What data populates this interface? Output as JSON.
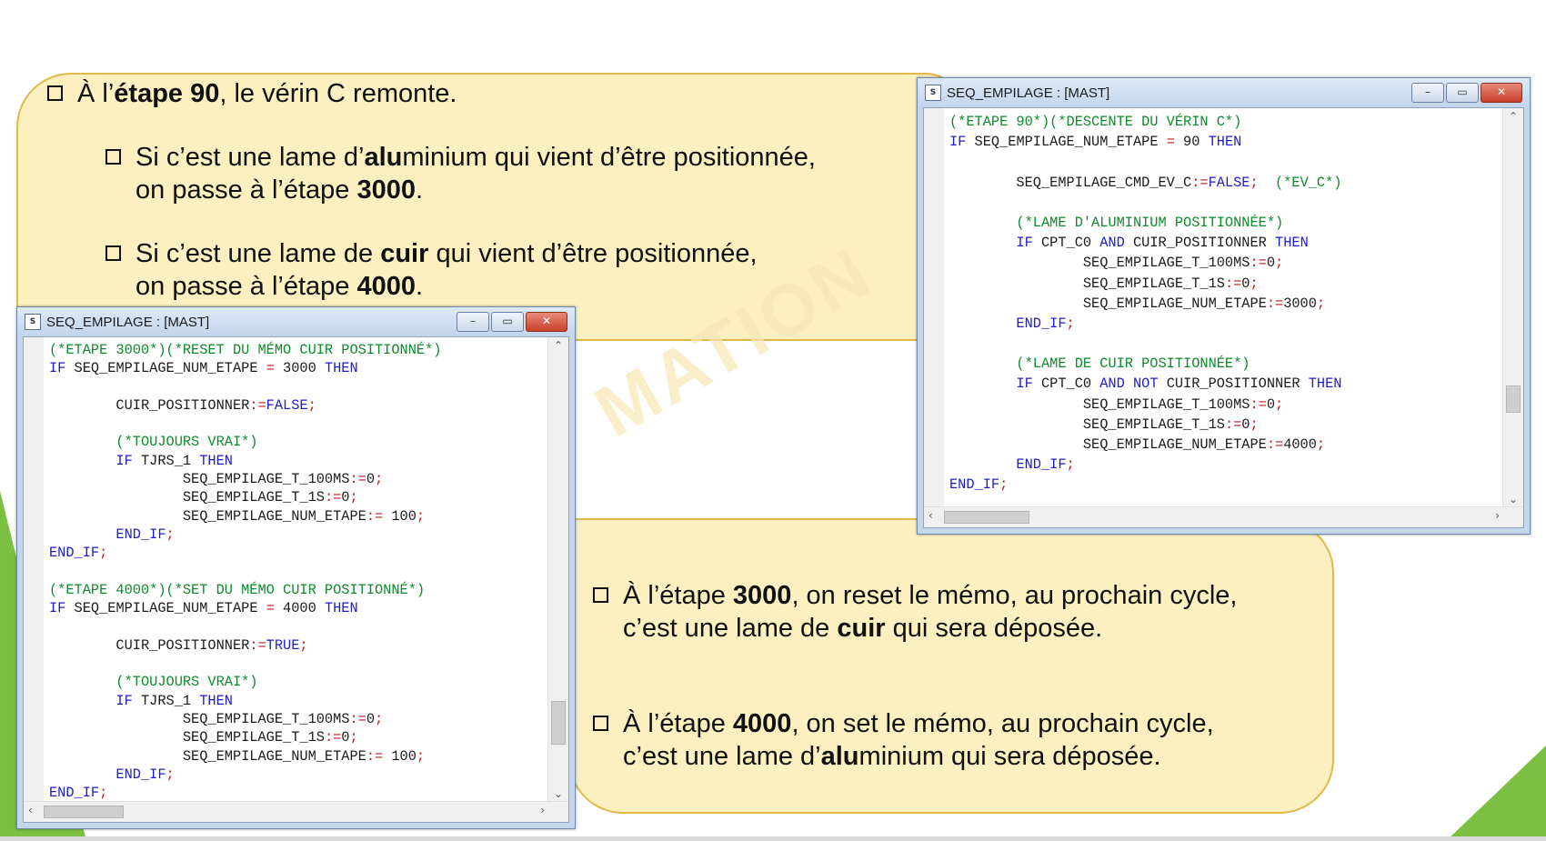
{
  "top_callout": {
    "b1": {
      "pre": "À l’",
      "bold": "étape 90",
      "post": ", le vérin C remonte."
    },
    "b2": {
      "pre": "Si c’est une lame d’",
      "bold": "alu",
      "post": "minium qui vient d’être positionnée,",
      "l2pre": "on passe à l’étape ",
      "l2bold": "3000",
      "l2post": "."
    },
    "b3": {
      "pre": "Si c’est une lame de ",
      "bold": "cuir",
      "post": " qui vient d’être positionnée,",
      "l2pre": "on passe à l’étape ",
      "l2bold": "4000",
      "l2post": "."
    }
  },
  "bottom_callout": {
    "b1": {
      "pre": "À l’étape ",
      "bold": "3000",
      "post": ", on reset le mémo, au prochain cycle,",
      "l2pre": "c’est une lame de ",
      "l2bold": "cuir",
      "l2post": " qui sera déposée."
    },
    "b2": {
      "pre": "À l’étape ",
      "bold": "4000",
      "post": ", on set le mémo, au prochain cycle,",
      "l2pre": "c’est une lame d’",
      "l2bold": "alu",
      "l2post": "minium qui sera déposée."
    }
  },
  "watermark": "MATION",
  "window_left": {
    "title": "SEQ_EMPILAGE : [MAST]",
    "icon": "st-editor-icon",
    "lines": [
      [
        [
          "c",
          "(*ETAPE 3000*)(*RESET DU MÉMO CUIR POSITIONNÉ*)"
        ]
      ],
      [
        [
          "k",
          "IF "
        ],
        [
          "i",
          "SEQ_EMPILAGE_NUM_ETAPE "
        ],
        [
          "o",
          "="
        ],
        [
          "i",
          " 3000 "
        ],
        [
          "k",
          "THEN"
        ]
      ],
      [],
      [
        [
          "i",
          "        CUIR_POSITIONNER"
        ],
        [
          "o",
          ":="
        ],
        [
          "k",
          "FALSE"
        ],
        [
          "o",
          ";"
        ]
      ],
      [],
      [
        [
          "c",
          "        (*TOUJOURS VRAI*)"
        ]
      ],
      [
        [
          "k",
          "        IF "
        ],
        [
          "i",
          "TJRS_1 "
        ],
        [
          "k",
          "THEN"
        ]
      ],
      [
        [
          "i",
          "                SEQ_EMPILAGE_T_100MS"
        ],
        [
          "o",
          ":="
        ],
        [
          "i",
          "0"
        ],
        [
          "o",
          ";"
        ]
      ],
      [
        [
          "i",
          "                SEQ_EMPILAGE_T_1S"
        ],
        [
          "o",
          ":="
        ],
        [
          "i",
          "0"
        ],
        [
          "o",
          ";"
        ]
      ],
      [
        [
          "i",
          "                SEQ_EMPILAGE_NUM_ETAPE"
        ],
        [
          "o",
          ":="
        ],
        [
          "i",
          " 100"
        ],
        [
          "o",
          ";"
        ]
      ],
      [
        [
          "k",
          "        END_IF"
        ],
        [
          "o",
          ";"
        ]
      ],
      [
        [
          "k",
          "END_IF"
        ],
        [
          "o",
          ";"
        ]
      ],
      [],
      [
        [
          "c",
          "(*ETAPE 4000*)(*SET DU MÉMO CUIR POSITIONNÉ*)"
        ]
      ],
      [
        [
          "k",
          "IF "
        ],
        [
          "i",
          "SEQ_EMPILAGE_NUM_ETAPE "
        ],
        [
          "o",
          "="
        ],
        [
          "i",
          " 4000 "
        ],
        [
          "k",
          "THEN"
        ]
      ],
      [],
      [
        [
          "i",
          "        CUIR_POSITIONNER"
        ],
        [
          "o",
          ":="
        ],
        [
          "k",
          "TRUE"
        ],
        [
          "o",
          ";"
        ]
      ],
      [],
      [
        [
          "c",
          "        (*TOUJOURS VRAI*)"
        ]
      ],
      [
        [
          "k",
          "        IF "
        ],
        [
          "i",
          "TJRS_1 "
        ],
        [
          "k",
          "THEN"
        ]
      ],
      [
        [
          "i",
          "                SEQ_EMPILAGE_T_100MS"
        ],
        [
          "o",
          ":="
        ],
        [
          "i",
          "0"
        ],
        [
          "o",
          ";"
        ]
      ],
      [
        [
          "i",
          "                SEQ_EMPILAGE_T_1S"
        ],
        [
          "o",
          ":="
        ],
        [
          "i",
          "0"
        ],
        [
          "o",
          ";"
        ]
      ],
      [
        [
          "i",
          "                SEQ_EMPILAGE_NUM_ETAPE"
        ],
        [
          "o",
          ":="
        ],
        [
          "i",
          " 100"
        ],
        [
          "o",
          ";"
        ]
      ],
      [
        [
          "k",
          "        END_IF"
        ],
        [
          "o",
          ";"
        ]
      ],
      [
        [
          "k",
          "END_IF"
        ],
        [
          "o",
          ";"
        ]
      ]
    ]
  },
  "window_right": {
    "title": "SEQ_EMPILAGE : [MAST]",
    "icon": "st-editor-icon",
    "lines": [
      [
        [
          "c",
          "(*ETAPE 90*)(*DESCENTE DU VÉRIN C*)"
        ]
      ],
      [
        [
          "k",
          "IF "
        ],
        [
          "i",
          "SEQ_EMPILAGE_NUM_ETAPE "
        ],
        [
          "o",
          "="
        ],
        [
          "i",
          " 90 "
        ],
        [
          "k",
          "THEN"
        ]
      ],
      [],
      [
        [
          "i",
          "        SEQ_EMPILAGE_CMD_EV_C"
        ],
        [
          "o",
          ":="
        ],
        [
          "k",
          "FALSE"
        ],
        [
          "o",
          ";"
        ],
        [
          "c",
          "  (*EV_C*)"
        ]
      ],
      [],
      [
        [
          "c",
          "        (*LAME D'ALUMINIUM POSITIONNÉE*)"
        ]
      ],
      [
        [
          "k",
          "        IF "
        ],
        [
          "i",
          "CPT_C0 "
        ],
        [
          "k",
          "AND "
        ],
        [
          "i",
          "CUIR_POSITIONNER "
        ],
        [
          "k",
          "THEN"
        ]
      ],
      [
        [
          "i",
          "                SEQ_EMPILAGE_T_100MS"
        ],
        [
          "o",
          ":="
        ],
        [
          "i",
          "0"
        ],
        [
          "o",
          ";"
        ]
      ],
      [
        [
          "i",
          "                SEQ_EMPILAGE_T_1S"
        ],
        [
          "o",
          ":="
        ],
        [
          "i",
          "0"
        ],
        [
          "o",
          ";"
        ]
      ],
      [
        [
          "i",
          "                SEQ_EMPILAGE_NUM_ETAPE"
        ],
        [
          "o",
          ":="
        ],
        [
          "i",
          "3000"
        ],
        [
          "o",
          ";"
        ]
      ],
      [
        [
          "k",
          "        END_IF"
        ],
        [
          "o",
          ";"
        ]
      ],
      [],
      [
        [
          "c",
          "        (*LAME DE CUIR POSITIONNÉE*)"
        ]
      ],
      [
        [
          "k",
          "        IF "
        ],
        [
          "i",
          "CPT_C0 "
        ],
        [
          "k",
          "AND NOT "
        ],
        [
          "i",
          "CUIR_POSITIONNER "
        ],
        [
          "k",
          "THEN"
        ]
      ],
      [
        [
          "i",
          "                SEQ_EMPILAGE_T_100MS"
        ],
        [
          "o",
          ":="
        ],
        [
          "i",
          "0"
        ],
        [
          "o",
          ";"
        ]
      ],
      [
        [
          "i",
          "                SEQ_EMPILAGE_T_1S"
        ],
        [
          "o",
          ":="
        ],
        [
          "i",
          "0"
        ],
        [
          "o",
          ";"
        ]
      ],
      [
        [
          "i",
          "                SEQ_EMPILAGE_NUM_ETAPE"
        ],
        [
          "o",
          ":="
        ],
        [
          "i",
          "4000"
        ],
        [
          "o",
          ";"
        ]
      ],
      [
        [
          "k",
          "        END_IF"
        ],
        [
          "o",
          ";"
        ]
      ],
      [
        [
          "k",
          "END_IF"
        ],
        [
          "o",
          ";"
        ]
      ]
    ]
  },
  "window_buttons": {
    "minimize": "–",
    "maximize": "▭",
    "close": "✕"
  },
  "scroll_arrows": {
    "up": "⌃",
    "down": "⌄",
    "left": "‹",
    "right": "›"
  },
  "colors": {
    "comment": "#0d8a2c",
    "keyword": "#1d1dcc",
    "operator": "#c01818",
    "callout_fill": "#fcf0c1",
    "callout_border": "#e0b94a",
    "accent_green": "#7bc043"
  }
}
